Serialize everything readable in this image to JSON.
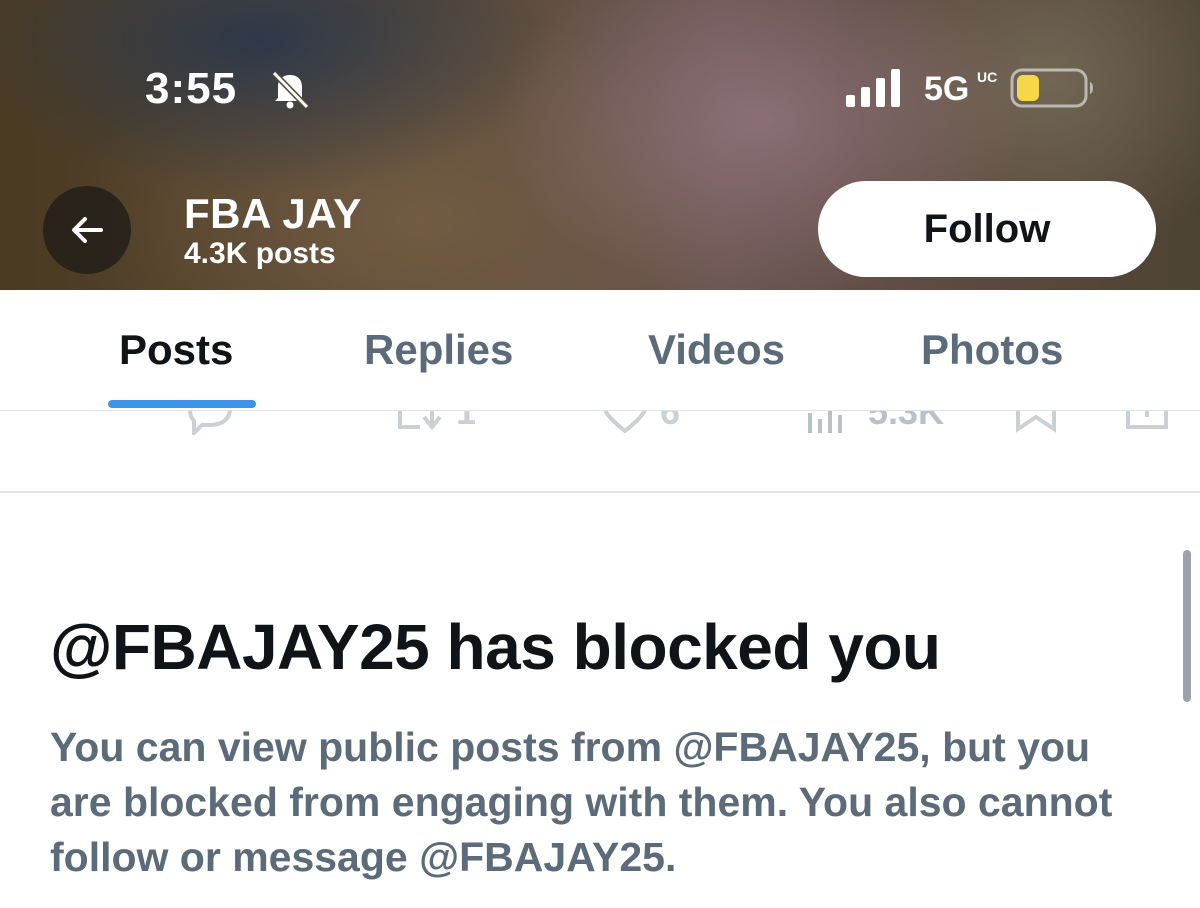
{
  "status_bar": {
    "time": "3:55",
    "network": "5G",
    "network_superscript": "UC",
    "battery_color": "#f7d748",
    "icons": [
      "bell-slash-icon",
      "cellular-signal-icon",
      "battery-low-icon"
    ]
  },
  "header": {
    "back_icon": "arrow-left-icon",
    "name": "FBA JAY",
    "posts_count": "4.3K posts",
    "follow_label": "Follow"
  },
  "tabs": [
    {
      "label": "Posts",
      "active": true
    },
    {
      "label": "Replies",
      "active": false
    },
    {
      "label": "Videos",
      "active": false
    },
    {
      "label": "Photos",
      "active": false
    }
  ],
  "accent_color": "#3f93e8",
  "post_actions": {
    "reposts": "1",
    "likes": "6",
    "views": "5.3K",
    "icons": [
      "reply-icon",
      "repost-icon",
      "like-icon",
      "views-icon",
      "bookmark-icon",
      "share-icon"
    ]
  },
  "blocked": {
    "title": "@FBAJAY25 has blocked you",
    "description": "You can view public posts from @FBAJAY25, but you are blocked from engaging with them. You also cannot follow or message @FBAJAY25."
  }
}
